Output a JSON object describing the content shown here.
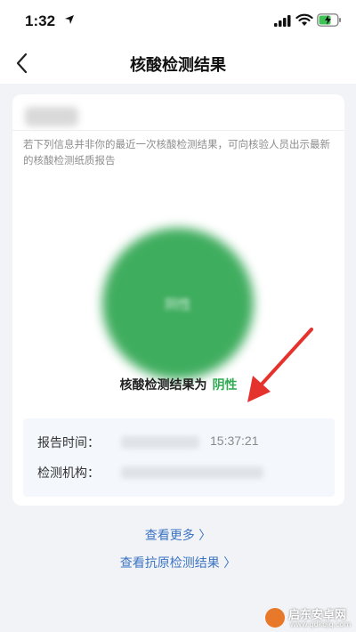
{
  "status_bar": {
    "time": "1:32",
    "icons": [
      "location-arrow-icon",
      "signal-icon",
      "wifi-icon",
      "battery-charging-icon"
    ]
  },
  "nav": {
    "title": "核酸检测结果",
    "back_icon": "chevron-left-icon"
  },
  "card": {
    "notice": "若下列信息并非你的最近一次核酸检测结果，可向核验人员出示最新的核酸检测纸质报告",
    "result_prefix": "核酸检测结果为",
    "result_value": "阴性",
    "result_circle_color": "#3fad5e",
    "result_circle_label": "阴性",
    "info": {
      "report_time_label": "报告时间：",
      "report_time_value": "15:37:21",
      "org_label": "检测机构："
    }
  },
  "links": {
    "more": "查看更多 〉",
    "antigen": "查看抗原检测结果 〉"
  },
  "colors": {
    "accent_green": "#2faa52",
    "link_blue": "#3c74c4",
    "annotation_red": "#e5322d"
  },
  "watermark": {
    "title": "启东安卓网",
    "url": "www.qdkdjq.com"
  }
}
